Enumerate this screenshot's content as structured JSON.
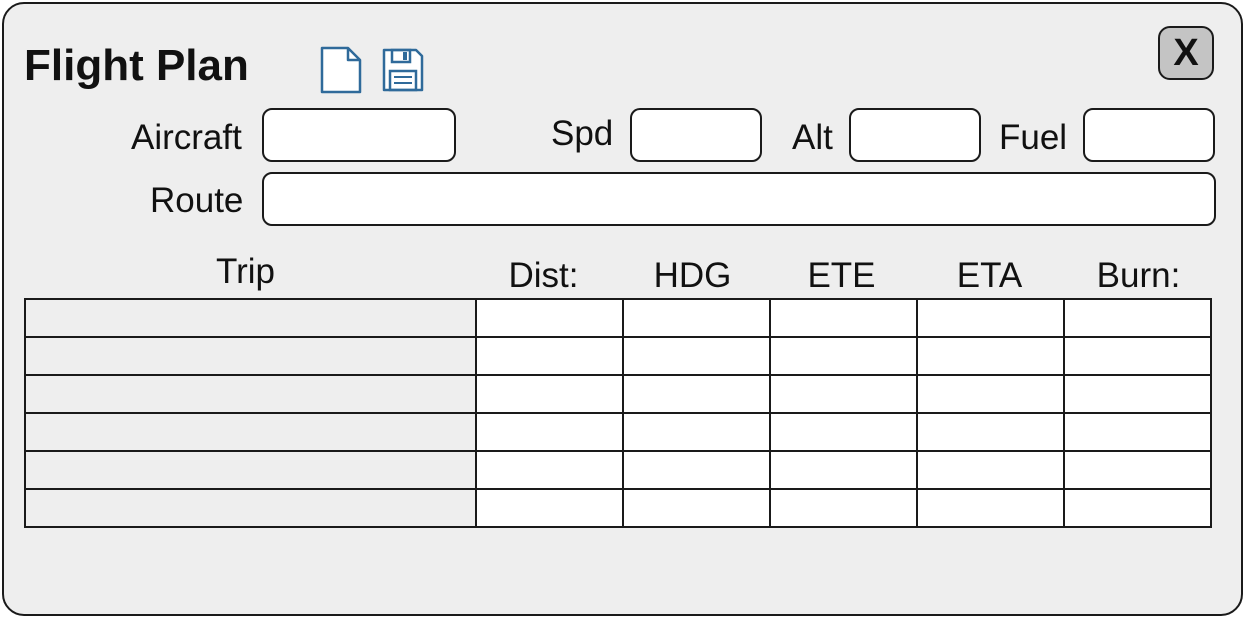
{
  "window": {
    "title": "Flight Plan",
    "close_label": "X"
  },
  "toolbar": {
    "new_icon": "new-document-icon",
    "save_icon": "floppy-disk-save-icon",
    "icon_color": "#2f6a9a"
  },
  "form": {
    "aircraft_label": "Aircraft",
    "aircraft_value": "",
    "spd_label": "Spd",
    "spd_value": "",
    "alt_label": "Alt",
    "alt_value": "",
    "fuel_label": "Fuel",
    "fuel_value": "",
    "route_label": "Route",
    "route_value": ""
  },
  "table": {
    "columns": [
      "Trip",
      "Dist:",
      "HDG",
      "ETE",
      "ETA",
      "Burn:"
    ],
    "rows": [
      [
        "",
        "",
        "",
        "",
        "",
        ""
      ],
      [
        "",
        "",
        "",
        "",
        "",
        ""
      ],
      [
        "",
        "",
        "",
        "",
        "",
        ""
      ],
      [
        "",
        "",
        "",
        "",
        "",
        ""
      ],
      [
        "",
        "",
        "",
        "",
        "",
        ""
      ],
      [
        "",
        "",
        "",
        "",
        "",
        ""
      ]
    ]
  },
  "colors": {
    "window_bg": "#eeeeee",
    "border": "#1a1a1a",
    "close_bg": "#c4c4c4"
  }
}
